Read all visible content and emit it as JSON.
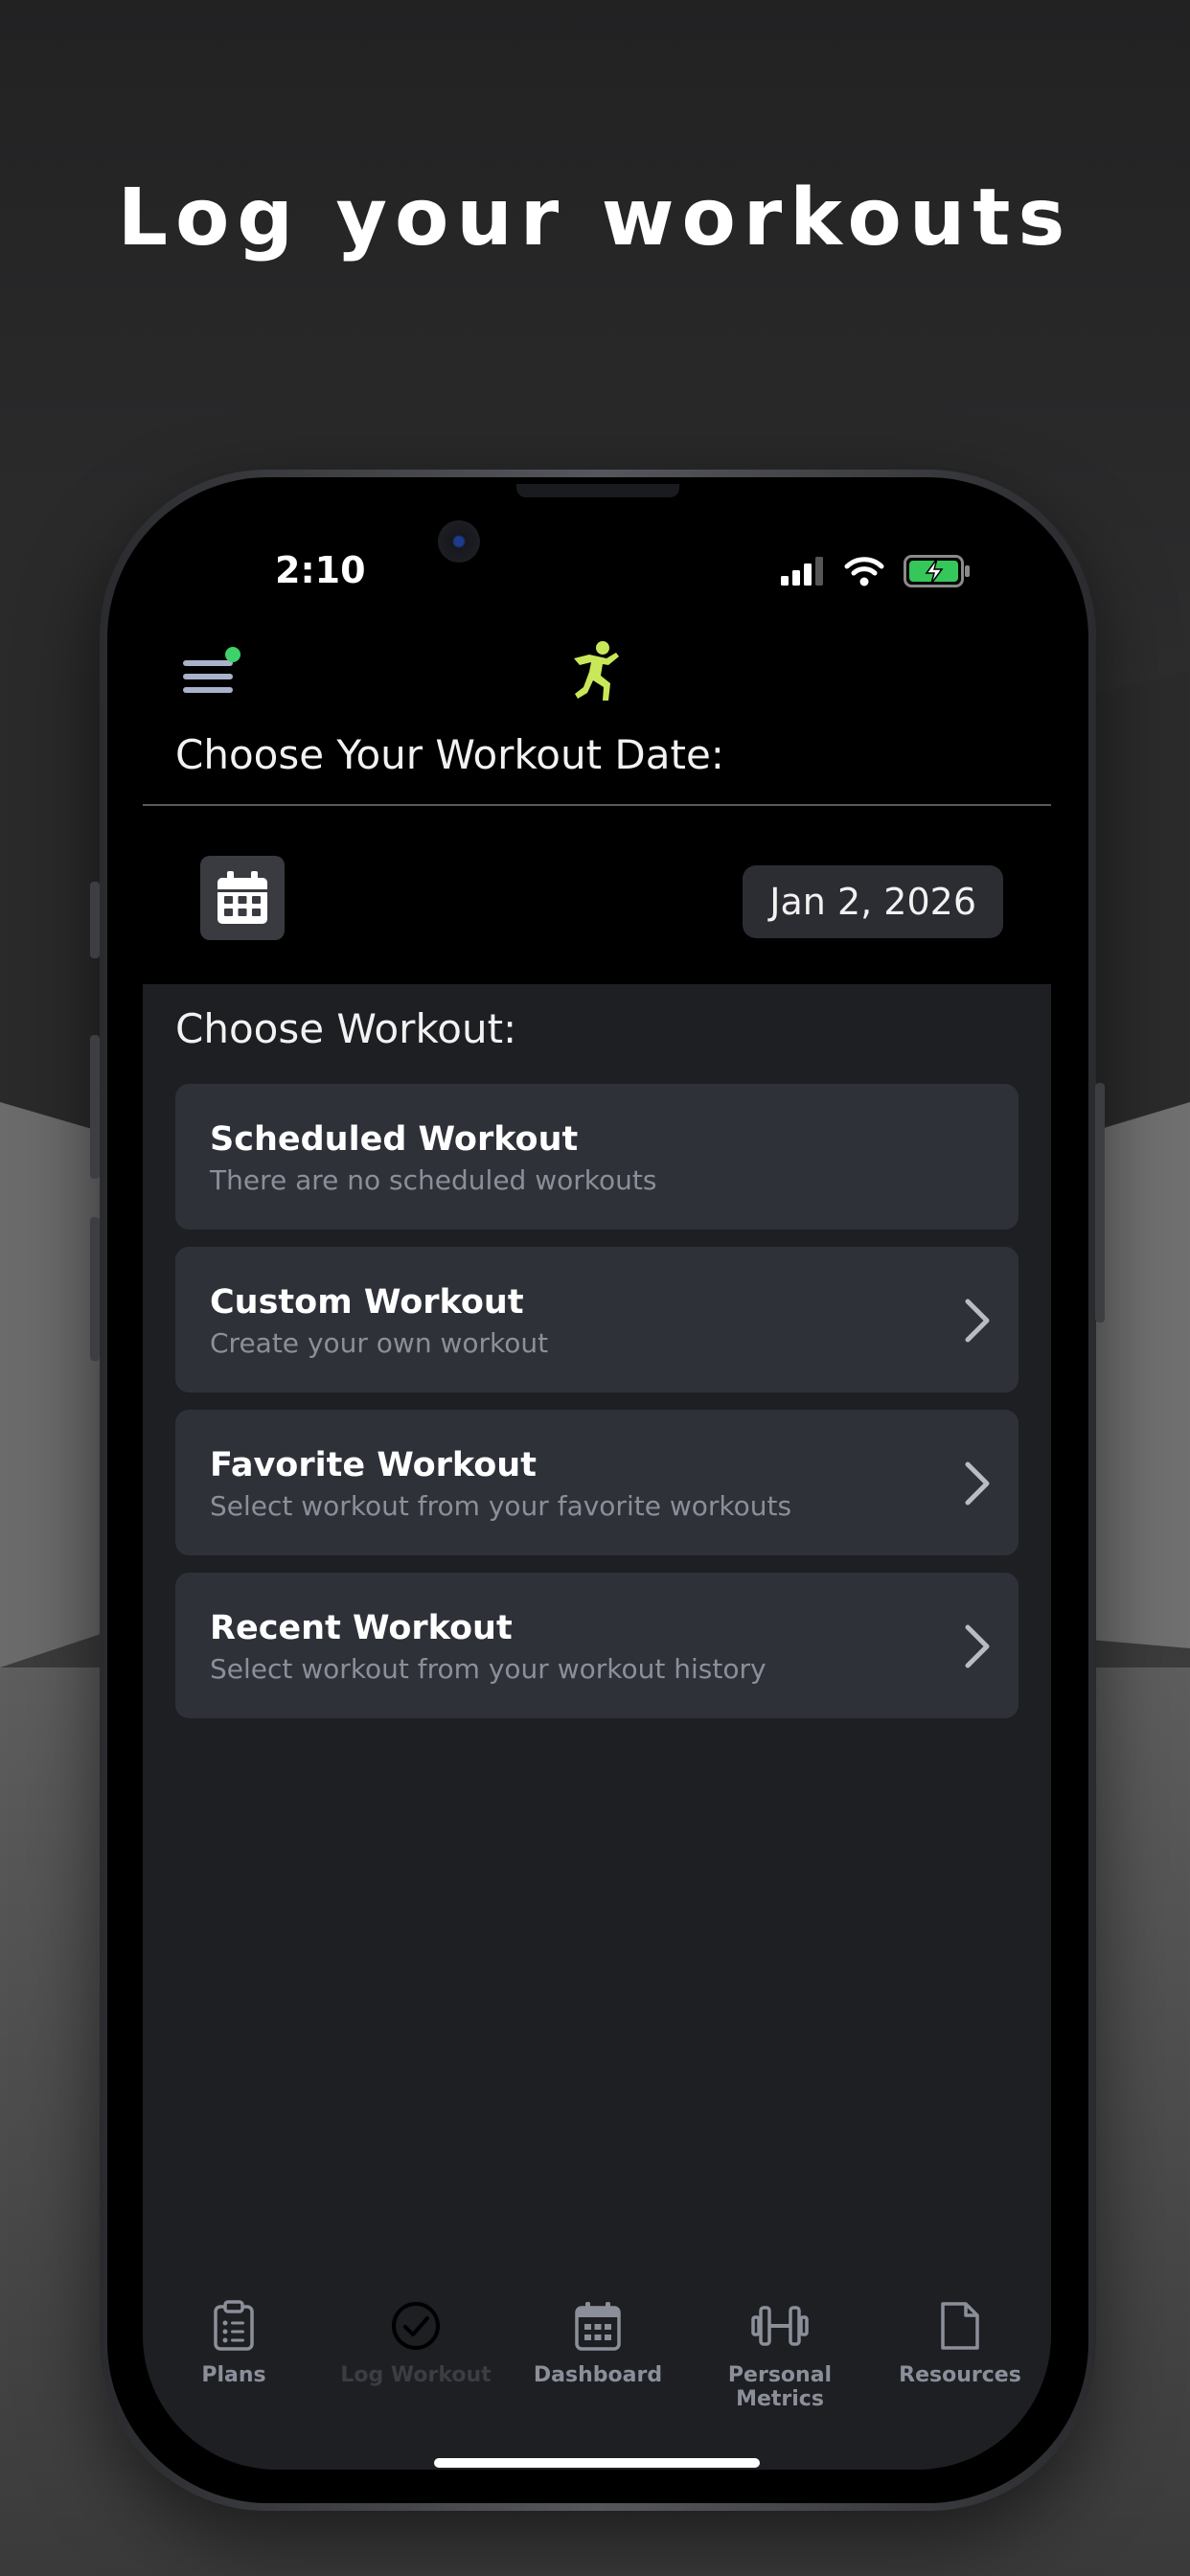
{
  "headline": "Log your workouts",
  "status": {
    "time": "2:10"
  },
  "header": {
    "logo_icon": "running-figure-icon",
    "accent": "#c8e85a"
  },
  "date_section": {
    "title": "Choose Your Workout Date:",
    "selected_date": "Jan 2, 2026"
  },
  "workout_section": {
    "title": "Choose Workout:",
    "options": [
      {
        "title": "Scheduled Workout",
        "subtitle": "There are no scheduled workouts",
        "has_chevron": false
      },
      {
        "title": "Custom Workout",
        "subtitle": "Create your own workout",
        "has_chevron": true
      },
      {
        "title": "Favorite Workout",
        "subtitle": "Select workout from your favorite workouts",
        "has_chevron": true
      },
      {
        "title": "Recent Workout",
        "subtitle": "Select workout from your workout history",
        "has_chevron": true
      }
    ]
  },
  "tabs": [
    {
      "label": "Plans",
      "icon": "clipboard-icon"
    },
    {
      "label": "Log Workout",
      "icon": "checkmark-circle-icon",
      "active": true
    },
    {
      "label": "Dashboard",
      "icon": "calendar-icon"
    },
    {
      "label": "Personal Metrics",
      "icon": "dumbbell-icon"
    },
    {
      "label": "Resources",
      "icon": "document-icon"
    }
  ]
}
